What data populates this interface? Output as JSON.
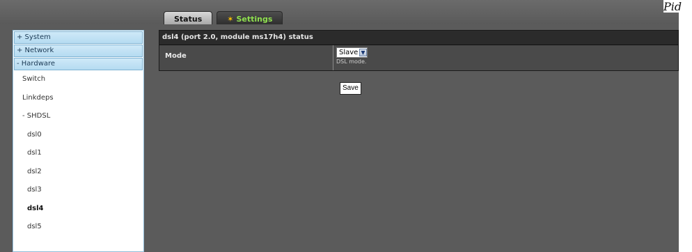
{
  "corner": {
    "text": "Pid"
  },
  "tabs": [
    {
      "label": "Status",
      "active": false
    },
    {
      "label": "Settings",
      "active": true
    }
  ],
  "sidebar": {
    "items": [
      {
        "label": "+ System",
        "type": "section"
      },
      {
        "label": "+ Network",
        "type": "section"
      },
      {
        "label": "- Hardware",
        "type": "section"
      },
      {
        "label": "Switch",
        "type": "item"
      },
      {
        "label": "Linkdeps",
        "type": "item"
      },
      {
        "label": "- SHDSL",
        "type": "item"
      },
      {
        "label": "dsl0",
        "type": "sub"
      },
      {
        "label": "dsl1",
        "type": "sub"
      },
      {
        "label": "dsl2",
        "type": "sub"
      },
      {
        "label": "dsl3",
        "type": "sub"
      },
      {
        "label": "dsl4",
        "type": "sub",
        "selected": true
      },
      {
        "label": "dsl5",
        "type": "sub"
      }
    ]
  },
  "panel": {
    "title": "dsl4 (port 2.0, module ms17h4) status",
    "mode_label": "Mode",
    "mode_value": "Slave",
    "mode_hint": "DSL mode.",
    "save_label": "Save"
  },
  "colors": {
    "header": "#5f5f5f",
    "content": "#5b5b5b",
    "sidebar_section": "#c4e3f6",
    "active_tab_text": "#8fe04f"
  },
  "icons": {
    "settings_tab": "star-icon",
    "dropdown": "chevron-down-icon"
  }
}
